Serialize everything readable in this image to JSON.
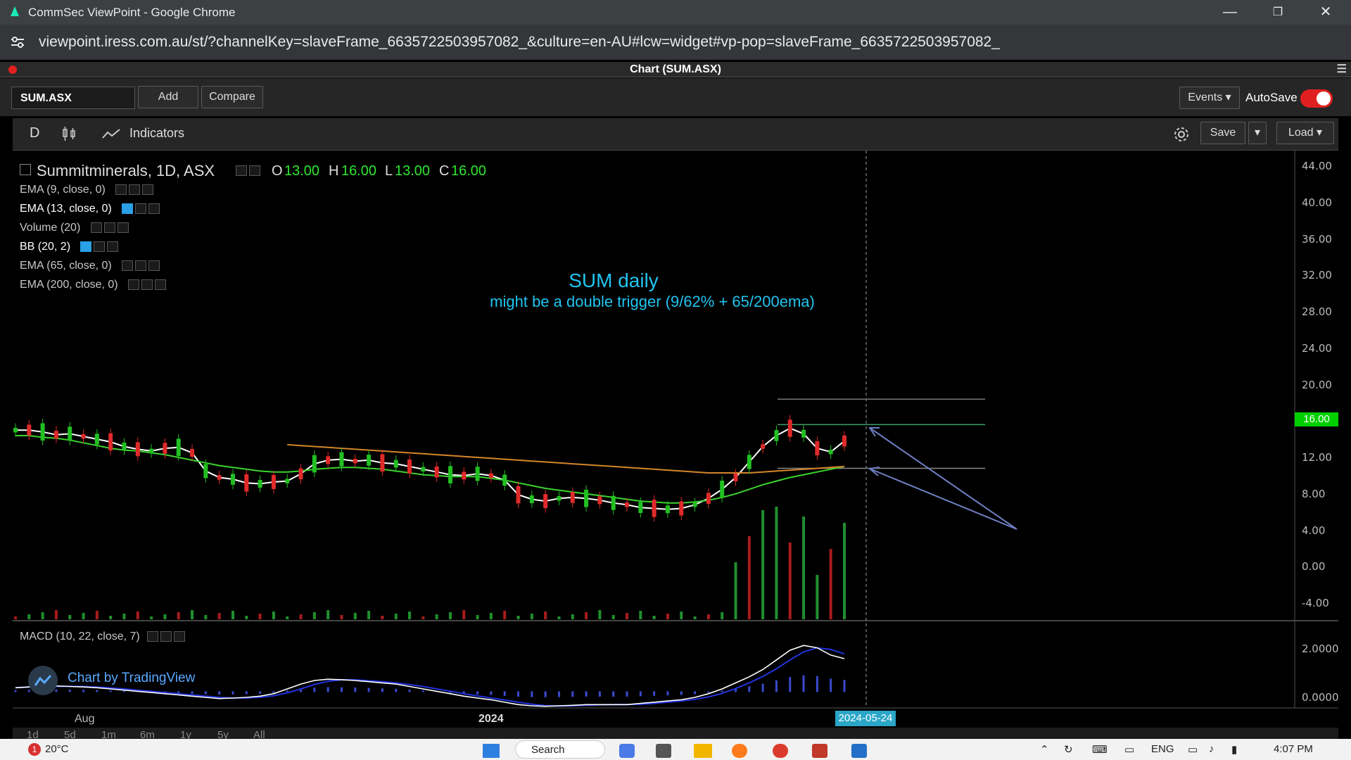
{
  "browser": {
    "window_title": "CommSec ViewPoint - Google Chrome",
    "url": "viewpoint.iress.com.au/st/?channelKey=slaveFrame_6635722503957082_&culture=en-AU#lcw=widget#vp-pop=slaveFrame_6635722503957082_"
  },
  "panel": {
    "title": "Chart (SUM.ASX)"
  },
  "toolbar": {
    "symbol": "SUM.ASX",
    "add": "Add",
    "compare": "Compare",
    "events": "Events ▾",
    "autosave": "AutoSave"
  },
  "chart_toolbar": {
    "interval": "D",
    "indicators": "Indicators",
    "save": "Save",
    "load": "Load ▾"
  },
  "legend": {
    "symbol_line": "Summitminerals, 1D, ASX",
    "open_label": "O",
    "open": "13.00",
    "high_label": "H",
    "high": "16.00",
    "low_label": "L",
    "low": "13.00",
    "close_label": "C",
    "close": "16.00"
  },
  "indicators": [
    "EMA (9, close, 0)",
    "EMA (13, close, 0)",
    "Volume (20)",
    "BB (20, 2)",
    "EMA (65, close, 0)",
    "EMA (200, close, 0)"
  ],
  "annotation": {
    "title": "SUM daily",
    "subtitle": "might be a double trigger (9/62% + 65/200ema)"
  },
  "price_axis": [
    "44.00",
    "40.00",
    "36.00",
    "32.00",
    "28.00",
    "24.00",
    "20.00",
    "16.00",
    "12.00",
    "8.00",
    "4.00",
    "0.00",
    "-4.00"
  ],
  "last_price": "16.00",
  "macd": {
    "label": "MACD (10, 22, close, 7)",
    "axis": [
      "2.0000",
      "0.0000"
    ]
  },
  "time_axis": {
    "labels": [
      "Aug",
      "2024"
    ],
    "cursor_date": "2024-05-24"
  },
  "ranges": [
    "1d",
    "5d",
    "1m",
    "6m",
    "1y",
    "5y",
    "All"
  ],
  "branding": "Chart by TradingView",
  "taskbar": {
    "weather": "20°C",
    "badge": "1",
    "search": "Search",
    "lang": "ENG",
    "time": "4:07 PM"
  },
  "chart_data": {
    "type": "line",
    "title": "",
    "ylim": [
      -4,
      44
    ],
    "series": [
      {
        "values": [
          15,
          15,
          14.8,
          14.5,
          14.6,
          14.3,
          14.0,
          13.7,
          13.2,
          12.9,
          12.7,
          13.0,
          13.1,
          12.5,
          10.5,
          9.8,
          9.6,
          9.2,
          9.1,
          9.3,
          9.4,
          10.2,
          11.3,
          11.7,
          11.8,
          11.6,
          11.7,
          11.4,
          11.3,
          11.0,
          10.7,
          10.4,
          10.1,
          10.0,
          10.2,
          10.0,
          9.5,
          7.9,
          7.4,
          7.2,
          7.5,
          7.6,
          7.5,
          7.3,
          7.0,
          6.8,
          6.5,
          6.4,
          6.3,
          6.4,
          6.8,
          7.5,
          8.5,
          9.8,
          11.5,
          13.2,
          14.4,
          15.2,
          14.6,
          13.0,
          12.6,
          13.8
        ]
      },
      {
        "values": [
          14.4,
          14.4,
          14.2,
          14.1,
          13.9,
          13.6,
          13.3,
          13.0,
          12.8,
          12.7,
          12.5,
          12.3,
          12.0,
          11.7,
          11.4,
          11.1,
          10.9,
          10.7,
          10.5,
          10.4,
          10.4,
          10.5,
          10.7,
          10.8,
          10.9,
          10.9,
          10.8,
          10.7,
          10.5,
          10.3,
          10.1,
          10.0,
          9.9,
          9.9,
          9.9,
          9.7,
          9.5,
          9.2,
          8.9,
          8.6,
          8.4,
          8.2,
          8.0,
          7.8,
          7.6,
          7.4,
          7.2,
          7.1,
          7.0,
          7.0,
          7.1,
          7.3,
          7.6,
          8.0,
          8.5,
          9.0,
          9.4,
          9.8,
          10.1,
          10.4,
          10.7,
          11.0
        ]
      },
      {
        "values": [
          null,
          null,
          null,
          null,
          null,
          null,
          null,
          null,
          null,
          null,
          null,
          null,
          null,
          null,
          null,
          null,
          null,
          null,
          null,
          null,
          13.4,
          13.3,
          13.2,
          13.1,
          13.0,
          12.9,
          12.8,
          12.7,
          12.6,
          12.5,
          12.4,
          12.3,
          12.2,
          12.1,
          12.0,
          11.9,
          11.8,
          11.7,
          11.6,
          11.5,
          11.4,
          11.3,
          11.2,
          11.1,
          11.0,
          10.9,
          10.8,
          10.7,
          10.6,
          10.5,
          10.4,
          10.3,
          10.3,
          10.3,
          10.3,
          10.4,
          10.5,
          10.6,
          10.7,
          10.8,
          10.9,
          11.0
        ]
      }
    ],
    "candles": {
      "last": {
        "open": 13,
        "high": 16,
        "low": 13,
        "close": 16
      }
    },
    "levels": [
      18.4,
      15.6,
      10.8
    ],
    "macd": {
      "ylim": [
        -0.6,
        2.4
      ],
      "values": [
        0.15,
        0.18,
        0.2,
        0.22,
        0.2,
        0.18,
        0.15,
        0.1,
        0.05,
        0.0,
        -0.05,
        -0.1,
        -0.15,
        -0.2,
        -0.25,
        -0.3,
        -0.28,
        -0.25,
        -0.2,
        -0.1,
        0.1,
        0.3,
        0.45,
        0.5,
        0.48,
        0.45,
        0.4,
        0.35,
        0.3,
        0.2,
        0.1,
        0.0,
        -0.1,
        -0.2,
        -0.28,
        -0.35,
        -0.45,
        -0.55,
        -0.6,
        -0.62,
        -0.6,
        -0.58,
        -0.55,
        -0.55,
        -0.55,
        -0.55,
        -0.5,
        -0.45,
        -0.4,
        -0.35,
        -0.25,
        -0.1,
        0.1,
        0.35,
        0.6,
        0.9,
        1.3,
        1.7,
        1.9,
        1.8,
        1.5,
        1.35
      ]
    }
  }
}
